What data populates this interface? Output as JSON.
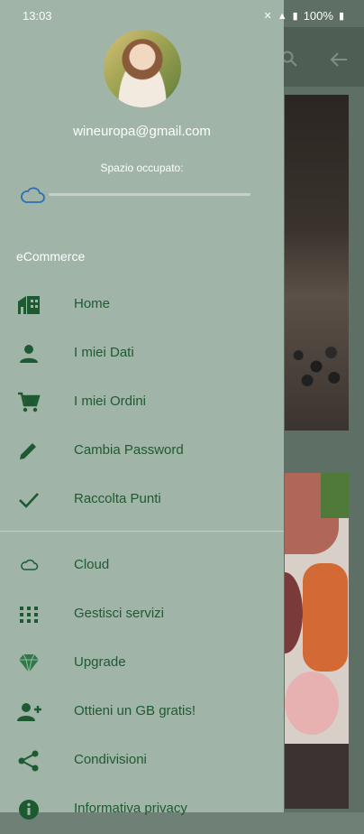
{
  "status_bar": {
    "time": "13:03",
    "battery": "100%"
  },
  "drawer": {
    "email": "wineuropa@gmail.com",
    "storage_label": "Spazio occupato:",
    "storage_used_fraction": 0,
    "section_label": "eCommerce",
    "ecommerce_items": [
      {
        "label": "Home",
        "icon": "store-icon"
      },
      {
        "label": "I miei Dati",
        "icon": "person-icon"
      },
      {
        "label": "I miei Ordini",
        "icon": "cart-icon"
      },
      {
        "label": "Cambia Password",
        "icon": "pencil-icon"
      },
      {
        "label": "Raccolta Punti",
        "icon": "check-icon"
      }
    ],
    "other_items": [
      {
        "label": "Cloud",
        "icon": "cloud-icon"
      },
      {
        "label": "Gestisci servizi",
        "icon": "grid-icon"
      },
      {
        "label": "Upgrade",
        "icon": "diamond-icon"
      },
      {
        "label": "Ottieni un GB gratis!",
        "icon": "add-user-icon"
      },
      {
        "label": "Condivisioni",
        "icon": "share-icon"
      },
      {
        "label": "Informativa privacy",
        "icon": "info-icon"
      }
    ]
  },
  "colors": {
    "drawer_bg": "#a0b4a8",
    "accent": "#1e5a31",
    "cloud_outline": "#2d6fb3"
  }
}
